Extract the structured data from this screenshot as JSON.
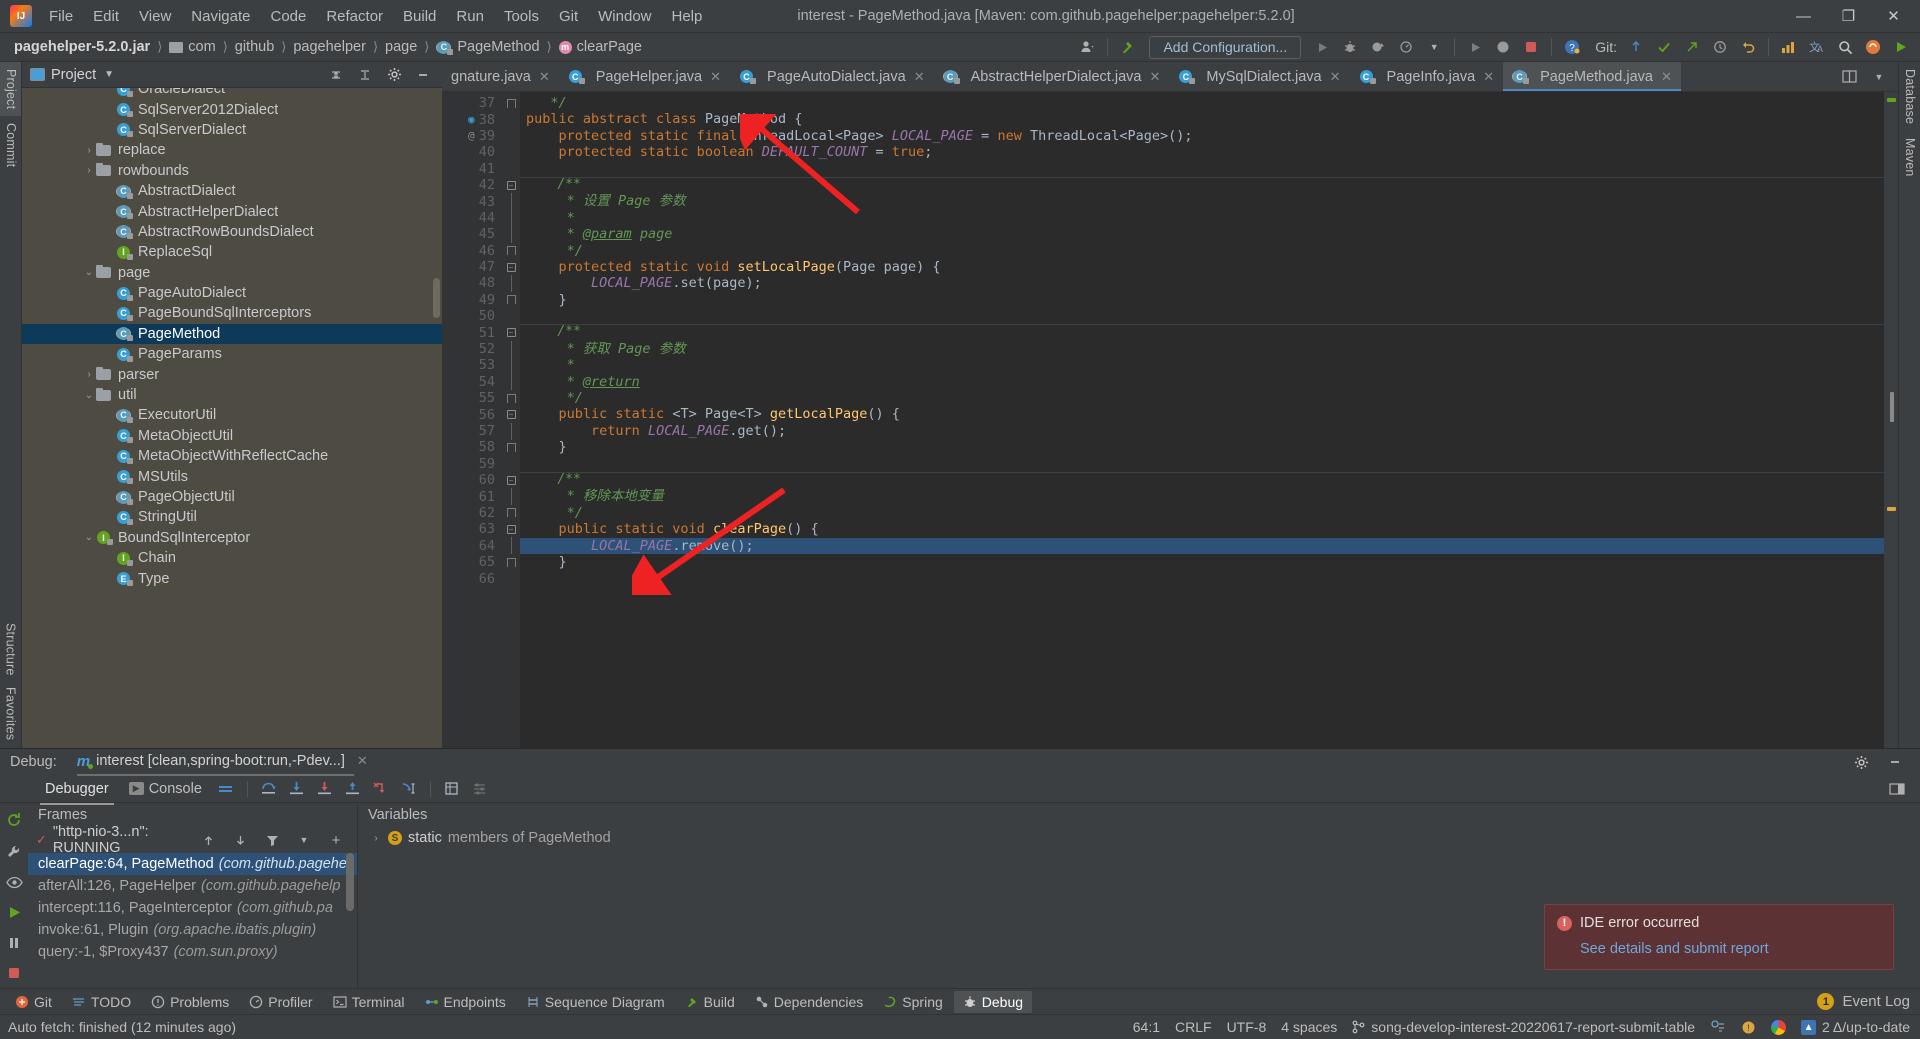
{
  "window": {
    "title": "interest - PageMethod.java [Maven: com.github.pagehelper:pagehelper:5.2.0]",
    "minimize": "—",
    "maximize": "❐",
    "close": "✕"
  },
  "menubar": [
    {
      "label": "File"
    },
    {
      "label": "Edit"
    },
    {
      "label": "View"
    },
    {
      "label": "Navigate"
    },
    {
      "label": "Code"
    },
    {
      "label": "Refactor"
    },
    {
      "label": "Build"
    },
    {
      "label": "Run"
    },
    {
      "label": "Tools"
    },
    {
      "label": "Git"
    },
    {
      "label": "Window"
    },
    {
      "label": "Help"
    }
  ],
  "breadcrumbs": [
    {
      "label": "pagehelper-5.2.0.jar",
      "icon": "",
      "bold": true
    },
    {
      "label": "com",
      "icon": ""
    },
    {
      "label": "github",
      "icon": ""
    },
    {
      "label": "pagehelper",
      "icon": ""
    },
    {
      "label": "page",
      "icon": ""
    },
    {
      "label": "PageMethod",
      "icon": "class-icon"
    },
    {
      "label": "clearPage",
      "icon": "method-icon"
    }
  ],
  "toolbar": {
    "add_configuration": "Add Configuration...",
    "git_label": "Git:",
    "icons": [
      "user-icon",
      "build-hammer-icon",
      "run-icon",
      "debug-icon",
      "coverage-icon",
      "profile-icon",
      "attach-icon",
      "stop-icon",
      "layout-icon",
      "help-icon",
      "search-icon",
      "updates-icon",
      "run-green-icon"
    ]
  },
  "left_strip": {
    "top": [
      {
        "label": "Project",
        "active": true
      },
      {
        "label": "Commit"
      }
    ],
    "bottom_icons": [
      "structure-icon",
      "wrench-icon",
      "eye-icon",
      "run-icon",
      "pause-icon",
      "star-icon",
      "chevrons-icon"
    ],
    "labels_bottom": [
      "Structure",
      "Favorites"
    ]
  },
  "right_strip": {
    "labels": [
      "Database",
      "Maven"
    ]
  },
  "project_panel": {
    "title": "Project",
    "caret": "▼",
    "actions": [
      "collapse-all-icon",
      "expand-all-icon",
      "settings-gear-icon",
      "hide-icon"
    ],
    "tree": [
      {
        "indent": 4,
        "chev": "",
        "icon": "class",
        "label": "OracleDialect",
        "partial": true
      },
      {
        "indent": 4,
        "chev": "",
        "icon": "class",
        "label": "SqlServer2012Dialect"
      },
      {
        "indent": 4,
        "chev": "",
        "icon": "class",
        "label": "SqlServerDialect"
      },
      {
        "indent": 3,
        "chev": "›",
        "icon": "folder",
        "label": "replace"
      },
      {
        "indent": 3,
        "chev": "›",
        "icon": "folder",
        "label": "rowbounds"
      },
      {
        "indent": 4,
        "chev": "",
        "icon": "abstract",
        "label": "AbstractDialect"
      },
      {
        "indent": 4,
        "chev": "",
        "icon": "abstract",
        "label": "AbstractHelperDialect"
      },
      {
        "indent": 4,
        "chev": "",
        "icon": "abstract",
        "label": "AbstractRowBoundsDialect"
      },
      {
        "indent": 4,
        "chev": "",
        "icon": "iface",
        "label": "ReplaceSql"
      },
      {
        "indent": 3,
        "chev": "⌄",
        "icon": "folder",
        "label": "page"
      },
      {
        "indent": 4,
        "chev": "",
        "icon": "class",
        "label": "PageAutoDialect"
      },
      {
        "indent": 4,
        "chev": "",
        "icon": "class",
        "label": "PageBoundSqlInterceptors"
      },
      {
        "indent": 4,
        "chev": "",
        "icon": "abstract",
        "label": "PageMethod",
        "selected": true
      },
      {
        "indent": 4,
        "chev": "",
        "icon": "class",
        "label": "PageParams"
      },
      {
        "indent": 3,
        "chev": "›",
        "icon": "folder",
        "label": "parser"
      },
      {
        "indent": 3,
        "chev": "⌄",
        "icon": "folder",
        "label": "util"
      },
      {
        "indent": 4,
        "chev": "",
        "icon": "abstract",
        "label": "ExecutorUtil"
      },
      {
        "indent": 4,
        "chev": "",
        "icon": "class",
        "label": "MetaObjectUtil"
      },
      {
        "indent": 4,
        "chev": "",
        "icon": "class",
        "label": "MetaObjectWithReflectCache"
      },
      {
        "indent": 4,
        "chev": "",
        "icon": "class",
        "label": "MSUtils"
      },
      {
        "indent": 4,
        "chev": "",
        "icon": "abstract",
        "label": "PageObjectUtil"
      },
      {
        "indent": 4,
        "chev": "",
        "icon": "class",
        "label": "StringUtil"
      },
      {
        "indent": 3,
        "chev": "⌄",
        "icon": "iface",
        "label": "BoundSqlInterceptor"
      },
      {
        "indent": 4,
        "chev": "",
        "icon": "iface",
        "label": "Chain"
      },
      {
        "indent": 4,
        "chev": "",
        "icon": "enum",
        "label": "Type",
        "partial": true
      }
    ]
  },
  "editor_tabs": [
    {
      "label": "gnature.java",
      "icon": "class-icon",
      "active": false,
      "clipped": true
    },
    {
      "label": "PageHelper.java",
      "icon": "class-icon",
      "active": false
    },
    {
      "label": "PageAutoDialect.java",
      "icon": "class-icon",
      "active": false
    },
    {
      "label": "AbstractHelperDialect.java",
      "icon": "abstract-icon",
      "active": false
    },
    {
      "label": "MySqlDialect.java",
      "icon": "class-icon",
      "active": false
    },
    {
      "label": "PageInfo.java",
      "icon": "class-icon",
      "active": false
    },
    {
      "label": "PageMethod.java",
      "icon": "abstract-icon",
      "active": true
    }
  ],
  "editor_tabs_actions": [
    "split-icon",
    "chevron-down-icon"
  ],
  "code": {
    "first_line": 37,
    "lines": [
      {
        "n": 37,
        "fold": "end",
        "gutter": "",
        "html": "   <span class='cm'>*/</span>"
      },
      {
        "n": 38,
        "fold": "",
        "gutter": "impl",
        "html": "<span class='k'>public abstract class </span><span class='ty'>PageMethod </span>{"
      },
      {
        "n": 39,
        "fold": "",
        "gutter": "at",
        "html": "    <span class='k'>protected static final </span>ThreadLocal&lt;Page&gt; <span class='fi'>LOCAL_PAGE </span>= <span class='k'>new </span>ThreadLocal&lt;Page&gt;();"
      },
      {
        "n": 40,
        "fold": "",
        "gutter": "",
        "html": "    <span class='k'>protected static boolean </span><span class='fi'>DEFAULT_COUNT </span>= <span class='k'>true</span>;"
      },
      {
        "n": 41,
        "fold": "",
        "gutter": "",
        "html": ""
      },
      {
        "n": 42,
        "fold": "start",
        "gutter": "",
        "sep": true,
        "html": "    <span class='cm'>/**</span>"
      },
      {
        "n": 43,
        "fold": "bar",
        "gutter": "",
        "html": "     <span class='cm'>* 设置 Page 参数</span>"
      },
      {
        "n": 44,
        "fold": "bar",
        "gutter": "",
        "html": "     <span class='cm'>*</span>"
      },
      {
        "n": 45,
        "fold": "bar",
        "gutter": "",
        "html": "     <span class='cm'>* </span><span class='tg'>@param</span><span class='cm'> page</span>"
      },
      {
        "n": 46,
        "fold": "end",
        "gutter": "",
        "html": "     <span class='cm'>*/</span>"
      },
      {
        "n": 47,
        "fold": "start",
        "gutter": "",
        "html": "    <span class='k'>protected static void </span><span class='fn'>setLocalPage</span>(Page page) {"
      },
      {
        "n": 48,
        "fold": "bar",
        "gutter": "",
        "html": "        <span class='fi'>LOCAL_PAGE</span>.set(page);"
      },
      {
        "n": 49,
        "fold": "end",
        "gutter": "",
        "html": "    }"
      },
      {
        "n": 50,
        "fold": "",
        "gutter": "",
        "html": ""
      },
      {
        "n": 51,
        "fold": "start",
        "gutter": "",
        "sep": true,
        "html": "    <span class='cm'>/**</span>"
      },
      {
        "n": 52,
        "fold": "bar",
        "gutter": "",
        "html": "     <span class='cm'>* 获取 Page 参数</span>"
      },
      {
        "n": 53,
        "fold": "bar",
        "gutter": "",
        "html": "     <span class='cm'>*</span>"
      },
      {
        "n": 54,
        "fold": "bar",
        "gutter": "",
        "html": "     <span class='cm'>* </span><span class='tg'>@return</span>"
      },
      {
        "n": 55,
        "fold": "end",
        "gutter": "",
        "html": "     <span class='cm'>*/</span>"
      },
      {
        "n": 56,
        "fold": "start",
        "gutter": "",
        "html": "    <span class='k'>public static </span>&lt;T&gt; Page&lt;T&gt; <span class='fn'>getLocalPage</span>() {"
      },
      {
        "n": 57,
        "fold": "bar",
        "gutter": "",
        "html": "        <span class='k'>return </span><span class='fi'>LOCAL_PAGE</span>.get();"
      },
      {
        "n": 58,
        "fold": "end",
        "gutter": "",
        "html": "    }"
      },
      {
        "n": 59,
        "fold": "",
        "gutter": "",
        "html": ""
      },
      {
        "n": 60,
        "fold": "start",
        "gutter": "",
        "sep": true,
        "html": "    <span class='cm'>/**</span>"
      },
      {
        "n": 61,
        "fold": "bar",
        "gutter": "",
        "html": "     <span class='cm'>* 移除本地变量</span>"
      },
      {
        "n": 62,
        "fold": "end",
        "gutter": "",
        "html": "     <span class='cm'>*/</span>"
      },
      {
        "n": 63,
        "fold": "start",
        "gutter": "",
        "html": "    <span class='k'>public static void </span><span class='fn'>clearPage</span>() {"
      },
      {
        "n": 64,
        "fold": "bar",
        "gutter": "",
        "html": "        <span class='fi'>LOCAL_PAGE</span>.remove();",
        "highlight": true
      },
      {
        "n": 65,
        "fold": "end",
        "gutter": "",
        "html": "    }"
      },
      {
        "n": 66,
        "fold": "",
        "gutter": "",
        "html": ""
      }
    ]
  },
  "debug": {
    "header_label": "Debug:",
    "session_name": "interest [clean,spring-boot:run,-Pdev...]",
    "session_close": "✕",
    "header_right": [
      "settings-gear-icon",
      "minimize-icon"
    ],
    "tabs": [
      {
        "label": "Debugger",
        "selected": true,
        "icon": ""
      },
      {
        "label": "Console",
        "selected": false,
        "icon": "console-icon"
      }
    ],
    "toolbar_icons": [
      "layout-icon",
      "step-over-icon",
      "step-into-icon",
      "force-step-into-icon",
      "step-out-icon",
      "drop-frame-icon",
      "run-to-cursor-icon",
      "evaluate-icon",
      "settings-icon"
    ],
    "left_icons": [
      "rerun-icon",
      "wrench-icon",
      "eye-icon",
      "resume-icon",
      "pause-icon",
      "stop-icon"
    ],
    "frames": {
      "title": "Frames",
      "thread": "\"http-nio-3...n\": RUNNING",
      "thread_icon": "check-icon",
      "toolbar_icons": [
        "up-arrow-icon",
        "down-arrow-icon",
        "filter-icon",
        "chevron-down-icon",
        "add-icon"
      ],
      "items": [
        {
          "method": "clearPage:64, PageMethod",
          "pkg": "(com.github.pagehel",
          "selected": true
        },
        {
          "method": "afterAll:126, PageHelper",
          "pkg": "(com.github.pagehelp",
          "selected": false
        },
        {
          "method": "intercept:116, PageInterceptor",
          "pkg": "(com.github.pa",
          "selected": false
        },
        {
          "method": "invoke:61, Plugin",
          "pkg": "(org.apache.ibatis.plugin)",
          "selected": false
        },
        {
          "method": "query:-1, $Proxy437",
          "pkg": "(com.sun.proxy)",
          "selected": false
        }
      ]
    },
    "variables": {
      "title": "Variables",
      "chev": "›",
      "badge": "S",
      "static_label": "static",
      "members_label": "members of PageMethod"
    },
    "error_balloon": {
      "icon": "error-icon",
      "title": "IDE error occurred",
      "link": "See details and submit report"
    }
  },
  "bottom_tabs": [
    {
      "label": "Git",
      "icon": "git-icon",
      "active": false
    },
    {
      "label": "TODO",
      "icon": "todo-icon",
      "active": false
    },
    {
      "label": "Problems",
      "icon": "problems-icon",
      "active": false
    },
    {
      "label": "Profiler",
      "icon": "profiler-icon",
      "active": false
    },
    {
      "label": "Terminal",
      "icon": "terminal-icon",
      "active": false
    },
    {
      "label": "Endpoints",
      "icon": "endpoints-icon",
      "active": false
    },
    {
      "label": "Sequence Diagram",
      "icon": "sequence-icon",
      "active": false
    },
    {
      "label": "Build",
      "icon": "build-icon",
      "active": false
    },
    {
      "label": "Dependencies",
      "icon": "dependencies-icon",
      "active": false
    },
    {
      "label": "Spring",
      "icon": "spring-icon",
      "active": false
    },
    {
      "label": "Debug",
      "icon": "debug-icon",
      "active": true
    }
  ],
  "bottom_right": {
    "event_count": "1",
    "event_log": "Event Log"
  },
  "statusbar": {
    "message": "Auto fetch: finished (12 minutes ago)",
    "caret": "64:1",
    "line_sep": "CRLF",
    "encoding": "UTF-8",
    "indent": "4 spaces",
    "branch": "song-develop-interest-20220617-report-submit-table",
    "branch_icon": "branch-icon",
    "update_status": "2 Δ/up-to-date",
    "icons": [
      "accessibility-icon",
      "notification-icon",
      "chrome-icon",
      "inspection-icon"
    ]
  },
  "colors": {
    "panel_bg": "#3c3f41",
    "tree_bg": "#4e4b42",
    "editor_bg": "#2b2b2b",
    "selection_blue": "#2d5177",
    "tree_selection": "#0d3a58",
    "accent_blue": "#4a88c7",
    "error_bg": "#5c3234",
    "arrow_red": "#ee2222"
  }
}
